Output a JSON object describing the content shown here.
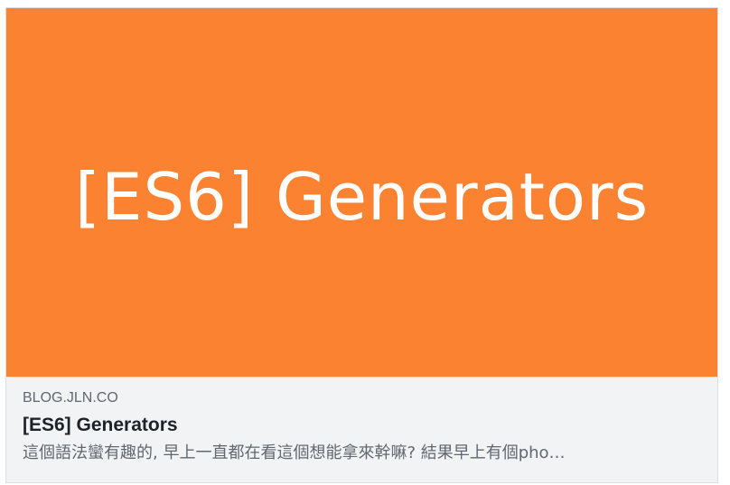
{
  "link_preview": {
    "image_text": "[ES6] Generators",
    "domain": "BLOG.JLN.CO",
    "title": "[ES6] Generators",
    "description": "這個語法蠻有趣的, 早上一直都在看這個想能拿來幹嘛? 結果早上有個pho…"
  },
  "colors": {
    "hero_background": "#fb8231",
    "meta_background": "#f2f3f5",
    "title_text": "#1d2129",
    "secondary_text": "#606770"
  }
}
